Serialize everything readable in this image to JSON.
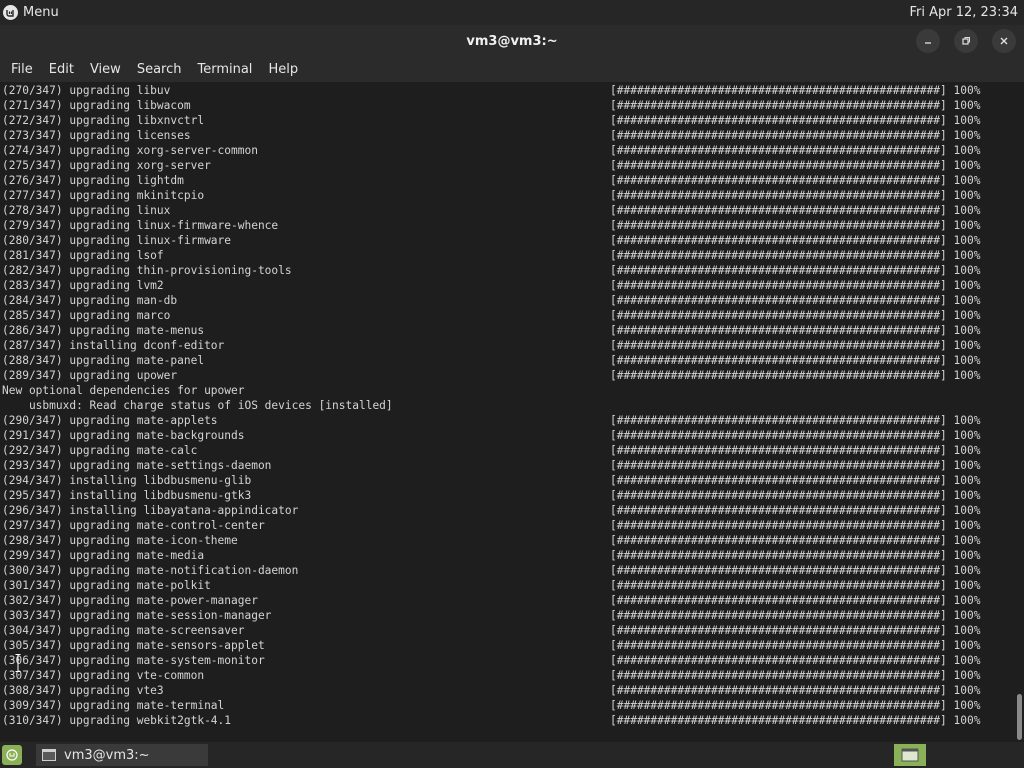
{
  "top_panel": {
    "menu_label": "Menu",
    "clock": "Fri Apr 12, 23:34"
  },
  "window": {
    "title": "vm3@vm3:~"
  },
  "menubar": [
    "File",
    "Edit",
    "View",
    "Search",
    "Terminal",
    "Help"
  ],
  "progress_bar": "[################################################] 100%",
  "terminal_lines": [
    {
      "text": "(270/347) upgrading libuv",
      "bar": true
    },
    {
      "text": "(271/347) upgrading libwacom",
      "bar": true
    },
    {
      "text": "(272/347) upgrading libxnvctrl",
      "bar": true
    },
    {
      "text": "(273/347) upgrading licenses",
      "bar": true
    },
    {
      "text": "(274/347) upgrading xorg-server-common",
      "bar": true
    },
    {
      "text": "(275/347) upgrading xorg-server",
      "bar": true
    },
    {
      "text": "(276/347) upgrading lightdm",
      "bar": true
    },
    {
      "text": "(277/347) upgrading mkinitcpio",
      "bar": true
    },
    {
      "text": "(278/347) upgrading linux",
      "bar": true
    },
    {
      "text": "(279/347) upgrading linux-firmware-whence",
      "bar": true
    },
    {
      "text": "(280/347) upgrading linux-firmware",
      "bar": true
    },
    {
      "text": "(281/347) upgrading lsof",
      "bar": true
    },
    {
      "text": "(282/347) upgrading thin-provisioning-tools",
      "bar": true
    },
    {
      "text": "(283/347) upgrading lvm2",
      "bar": true
    },
    {
      "text": "(284/347) upgrading man-db",
      "bar": true
    },
    {
      "text": "(285/347) upgrading marco",
      "bar": true
    },
    {
      "text": "(286/347) upgrading mate-menus",
      "bar": true
    },
    {
      "text": "(287/347) installing dconf-editor",
      "bar": true
    },
    {
      "text": "(288/347) upgrading mate-panel",
      "bar": true
    },
    {
      "text": "(289/347) upgrading upower",
      "bar": true
    },
    {
      "text": "New optional dependencies for upower",
      "bar": false
    },
    {
      "text": "    usbmuxd: Read charge status of iOS devices [installed]",
      "bar": false
    },
    {
      "text": "(290/347) upgrading mate-applets",
      "bar": true
    },
    {
      "text": "(291/347) upgrading mate-backgrounds",
      "bar": true
    },
    {
      "text": "(292/347) upgrading mate-calc",
      "bar": true
    },
    {
      "text": "(293/347) upgrading mate-settings-daemon",
      "bar": true
    },
    {
      "text": "(294/347) installing libdbusmenu-glib",
      "bar": true
    },
    {
      "text": "(295/347) installing libdbusmenu-gtk3",
      "bar": true
    },
    {
      "text": "(296/347) installing libayatana-appindicator",
      "bar": true
    },
    {
      "text": "(297/347) upgrading mate-control-center",
      "bar": true
    },
    {
      "text": "(298/347) upgrading mate-icon-theme",
      "bar": true
    },
    {
      "text": "(299/347) upgrading mate-media",
      "bar": true
    },
    {
      "text": "(300/347) upgrading mate-notification-daemon",
      "bar": true
    },
    {
      "text": "(301/347) upgrading mate-polkit",
      "bar": true
    },
    {
      "text": "(302/347) upgrading mate-power-manager",
      "bar": true
    },
    {
      "text": "(303/347) upgrading mate-session-manager",
      "bar": true
    },
    {
      "text": "(304/347) upgrading mate-screensaver",
      "bar": true
    },
    {
      "text": "(305/347) upgrading mate-sensors-applet",
      "bar": true
    },
    {
      "text": "(306/347) upgrading mate-system-monitor",
      "bar": true
    },
    {
      "text": "(307/347) upgrading vte-common",
      "bar": true
    },
    {
      "text": "(308/347) upgrading vte3",
      "bar": true
    },
    {
      "text": "(309/347) upgrading mate-terminal",
      "bar": true
    },
    {
      "text": "(310/347) upgrading webkit2gtk-4.1",
      "bar": true
    }
  ],
  "taskbar": {
    "task_label": "vm3@vm3:~"
  },
  "colors": {
    "panel": "#262626",
    "accent": "#8bb158",
    "terminal_bg": "#1e1e1e"
  },
  "icons": [
    "mint-menu-icon",
    "minimize-icon",
    "maximize-icon",
    "close-icon",
    "terminal-app-icon",
    "workspace-icon"
  ]
}
